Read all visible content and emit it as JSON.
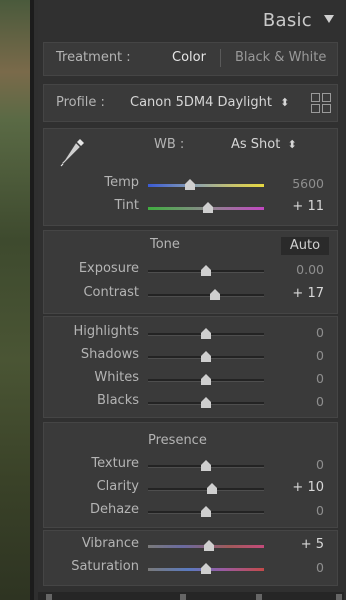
{
  "panel": {
    "title": "Basic",
    "collapse_icon": "triangle-down-icon"
  },
  "treatment": {
    "label": "Treatment :",
    "options": [
      "Color",
      "Black & White"
    ],
    "selected": "Color"
  },
  "profile": {
    "label": "Profile :",
    "value": "Canon 5DM4 Daylight",
    "browse_icon": "grid-icon"
  },
  "wb": {
    "label": "WB :",
    "value": "As Shot",
    "eyedropper_icon": "eyedropper-icon",
    "sliders": [
      {
        "label": "Temp",
        "value": "5600",
        "pos": 0.36,
        "highlight": false,
        "style": "temp"
      },
      {
        "label": "Tint",
        "value": "+ 11",
        "pos": 0.52,
        "highlight": true,
        "style": "tint"
      }
    ]
  },
  "tone": {
    "title": "Tone",
    "auto_label": "Auto",
    "sliders": [
      {
        "label": "Exposure",
        "value": "0.00",
        "pos": 0.5,
        "highlight": false
      },
      {
        "label": "Contrast",
        "value": "+ 17",
        "pos": 0.58,
        "highlight": true
      }
    ]
  },
  "tone2": {
    "sliders": [
      {
        "label": "Highlights",
        "value": "0",
        "pos": 0.5,
        "highlight": false
      },
      {
        "label": "Shadows",
        "value": "0",
        "pos": 0.5,
        "highlight": false
      },
      {
        "label": "Whites",
        "value": "0",
        "pos": 0.5,
        "highlight": false
      },
      {
        "label": "Blacks",
        "value": "0",
        "pos": 0.5,
        "highlight": false
      }
    ]
  },
  "presence": {
    "title": "Presence",
    "sliders": [
      {
        "label": "Texture",
        "value": "0",
        "pos": 0.5,
        "highlight": false
      },
      {
        "label": "Clarity",
        "value": "+ 10",
        "pos": 0.55,
        "highlight": true
      },
      {
        "label": "Dehaze",
        "value": "0",
        "pos": 0.5,
        "highlight": false
      }
    ]
  },
  "color": {
    "sliders": [
      {
        "label": "Vibrance",
        "value": "+ 5",
        "pos": 0.53,
        "highlight": true,
        "style": "vibrance"
      },
      {
        "label": "Saturation",
        "value": "0",
        "pos": 0.5,
        "highlight": false,
        "style": "saturation"
      }
    ]
  }
}
